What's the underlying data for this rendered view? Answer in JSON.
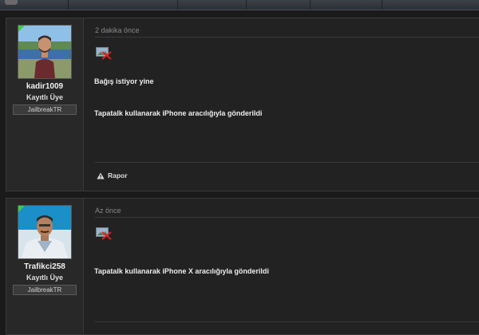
{
  "posts": [
    {
      "username": "kadir1009",
      "role": "Kayıtlı Üye",
      "group": "JailbreakTR",
      "time": "2 dakika önce",
      "message": "Bağış istiyor yine",
      "signature": "Tapatalk kullanarak iPhone aracılığıyla gönderildi",
      "report_label": "Rapor"
    },
    {
      "username": "Trafikci258",
      "role": "Kayıtlı Üye",
      "group": "JailbreakTR",
      "time": "Az önce",
      "signature": "Tapatalk kullanarak iPhone X aracılığıyla gönderildi"
    }
  ],
  "icons": {
    "broken_image": "broken-image-icon",
    "report": "warning-triangle-icon"
  },
  "colors": {
    "online_badge": "#45c845"
  }
}
